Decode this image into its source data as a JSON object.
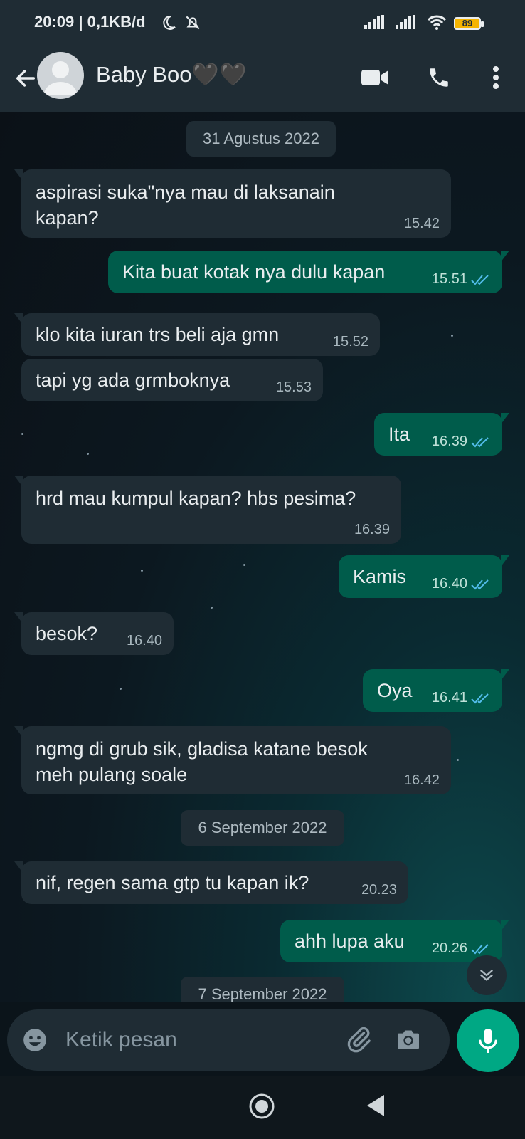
{
  "status_bar": {
    "time": "20:09 | 0,1KB/d",
    "battery": "89"
  },
  "header": {
    "contact_name": "Baby Boo🖤🖤"
  },
  "dates": {
    "d1": "31 Agustus 2022",
    "d2": "6 September 2022",
    "d3": "7 September 2022"
  },
  "messages": [
    {
      "dir": "in",
      "text1": "aspirasi suka\"nya mau di laksanain",
      "text2": "kapan?",
      "time": "15.42"
    },
    {
      "dir": "out",
      "text1": "Kita buat kotak nya dulu kapan",
      "time": "15.51"
    },
    {
      "dir": "in",
      "text1": "klo kita iuran trs beli aja gmn",
      "time": "15.52"
    },
    {
      "dir": "in",
      "text1": "tapi yg ada grmboknya",
      "time": "15.53"
    },
    {
      "dir": "out",
      "text1": "Ita",
      "time": "16.39"
    },
    {
      "dir": "in",
      "text1": "hrd mau kumpul kapan? hbs pesima?",
      "time": "16.39"
    },
    {
      "dir": "out",
      "text1": "Kamis",
      "time": "16.40"
    },
    {
      "dir": "in",
      "text1": "besok?",
      "time": "16.40"
    },
    {
      "dir": "out",
      "text1": "Oya",
      "time": "16.41"
    },
    {
      "dir": "in",
      "text1": "ngmg di grub sik, gladisa katane besok",
      "text2": "meh pulang soale",
      "time": "16.42"
    },
    {
      "dir": "in",
      "text1": "nif, regen sama gtp tu kapan ik?",
      "time": "20.23"
    },
    {
      "dir": "out",
      "text1": "ahh lupa aku",
      "time": "20.26"
    }
  ],
  "composer": {
    "placeholder": "Ketik pesan"
  },
  "icons": {
    "back": "arrow-left-icon",
    "video": "video-call-icon",
    "call": "phone-icon",
    "menu": "more-vert-icon",
    "emoji": "emoji-icon",
    "attach": "paperclip-icon",
    "camera": "camera-icon",
    "mic": "microphone-icon"
  },
  "colors": {
    "incoming": "#1f2c34",
    "outgoing": "#005c4b",
    "accent": "#00a884",
    "read_ticks": "#53bdeb"
  }
}
